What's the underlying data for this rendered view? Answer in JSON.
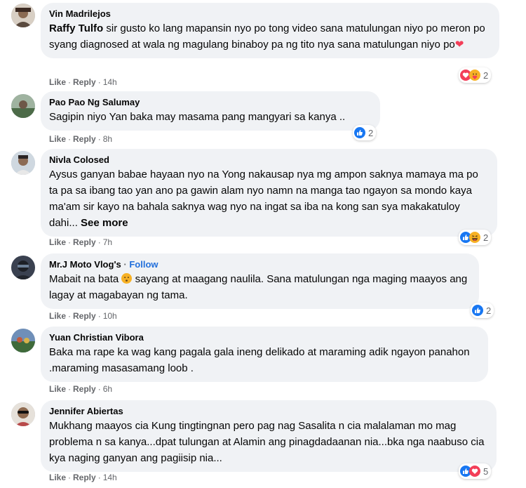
{
  "actions": {
    "like": "Like",
    "reply": "Reply",
    "separator": "·"
  },
  "colors": {
    "bubble": "#f0f2f5",
    "link": "#216fdb",
    "like": "#1877f2",
    "love": "#f33e58",
    "care": "#f7b125"
  },
  "comments": [
    {
      "author": "Vin Madrilejos",
      "mention": "Raffy Tulfo",
      "text": " sir gusto ko lang mapansin nyo po tong video sana matulungan niyo po meron po syang diagnosed at wala ng magulang binaboy pa ng tito nya sana matulungan niyo po",
      "emoji": "❤️",
      "time": "14h",
      "reactions": [
        "love-icon",
        "care-icon"
      ],
      "count": "2"
    },
    {
      "author": "Pao Pao Ng Salumay",
      "text": "Sagipin niyo Yan baka may masama pang mangyari sa kanya ..",
      "time": "8h",
      "reactions": [
        "like-icon"
      ],
      "count": "2"
    },
    {
      "author": "Nivla Colosed",
      "text": "Aysus ganyan babae hayaan nyo na Yong nakausap nya mg ampon saknya mamaya ma po ta pa sa ibang tao yan ano pa gawin alam nyo namn na manga tao ngayon sa mondo kaya ma'am sir kayo na bahala saknya wag nyo na ingat sa iba na kong san sya makakatuloy dahi...",
      "see_more": "See more",
      "time": "7h",
      "reactions": [
        "like-icon",
        "haha-icon"
      ],
      "count": "2"
    },
    {
      "author": "Mr.J Moto Vlog's",
      "follow": "Follow",
      "text_before": "Mabait na bata ",
      "emoji": "😦",
      "text_after": " sayang at maagang naulila. Sana matulungan nga maging maayos ang lagay at magabayan ng tama.",
      "time": "10h",
      "reactions": [
        "like-icon"
      ],
      "count": "2"
    },
    {
      "author": "Yuan Christian Vibora",
      "text": "Baka ma rape ka wag kang pagala gala ineng delikado at maraming adik ngayon panahon .maraming masasamang loob .",
      "time": "6h",
      "reactions": [],
      "count": ""
    },
    {
      "author": "Jennifer Abiertas",
      "text": "Mukhang maayos cia Kung tingtingnan pero pag nag Sasalita n cia malalaman mo mag problema n sa kanya...dpat tulungan at Alamin ang pinagdadaanan nia...bka nga naabuso cia kya naging ganyan ang pagiisip nia...",
      "time": "14h",
      "reactions": [
        "like-icon",
        "love-icon"
      ],
      "count": "5"
    }
  ]
}
